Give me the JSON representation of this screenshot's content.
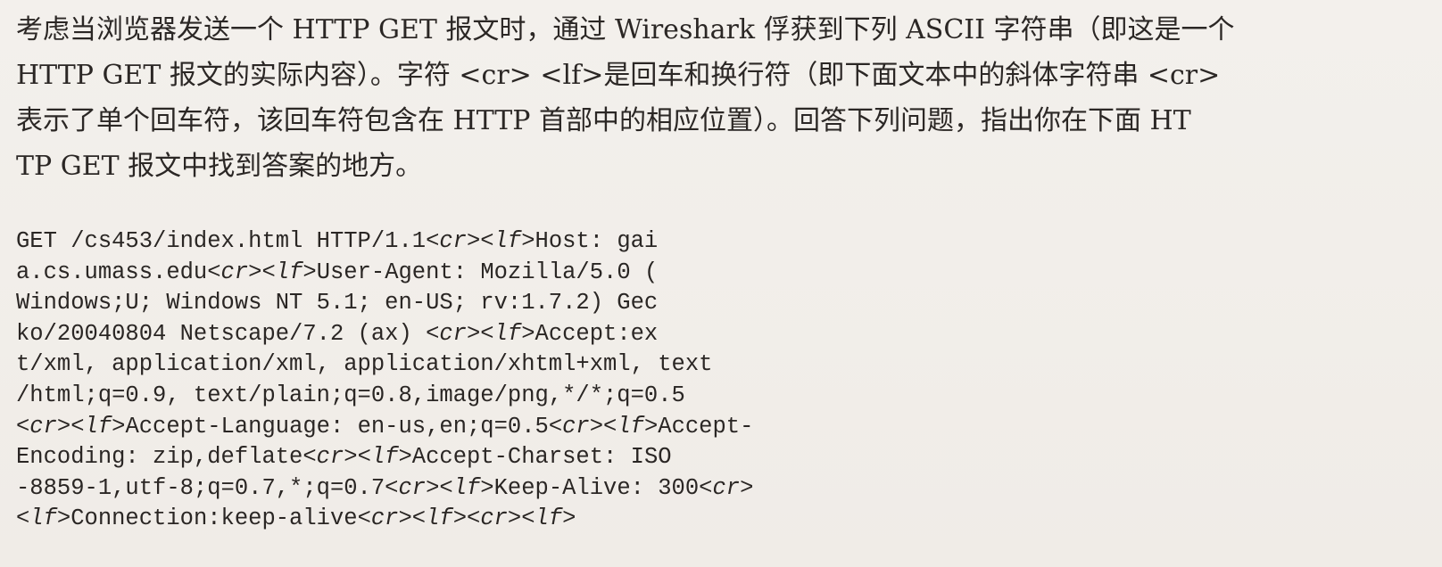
{
  "question": {
    "lines": [
      "考虑当浏览器发送一个 HTTP GET 报文时，通过 Wireshark 俘获到下列 ASCII 字符串（即这是一个",
      "HTTP GET 报文的实际内容）。字符 <cr> <lf>是回车和换行符（即下面文本中的斜体字符串 <cr>",
      "表示了单个回车符，该回车符包含在 HTTP 首部中的相应位置）。回答下列问题，指出你在下面 HT",
      "TP GET 报文中找到答案的地方。"
    ]
  },
  "http_message": {
    "lines": [
      [
        "GET /cs453/index.html HTTP/1.1",
        "<cr>",
        "<lf>",
        "Host: gai"
      ],
      [
        "a.cs.umass.edu",
        "<cr>",
        "<lf>",
        "User-Agent: Mozilla/5.0 ("
      ],
      [
        "Windows;U; Windows NT 5.1; en-US; rv:1.7.2) Gec"
      ],
      [
        "ko/20040804 Netscape/7.2 (ax) ",
        "<cr>",
        "<lf>",
        "Accept:ex"
      ],
      [
        "t/xml, application/xml, application/xhtml+xml, text"
      ],
      [
        "/html;q=0.9, text/plain;q=0.8,image/png,*/*;q=0.5"
      ],
      [
        "",
        "<cr>",
        "<lf>",
        "Accept-Language: en-us,en;q=0.5",
        "<cr>",
        "<lf>",
        "Accept-"
      ],
      [
        "Encoding: zip,deflate",
        "<cr>",
        "<lf>",
        "Accept-Charset: ISO"
      ],
      [
        "-8859-1,utf-8;q=0.7,*;q=0.7",
        "<cr>",
        "<lf>",
        "Keep-Alive: 300",
        "<cr>"
      ],
      [
        "",
        "<lf>",
        "Connection:keep-alive",
        "<cr>",
        "<lf>",
        "<cr>",
        "<lf>"
      ]
    ]
  }
}
